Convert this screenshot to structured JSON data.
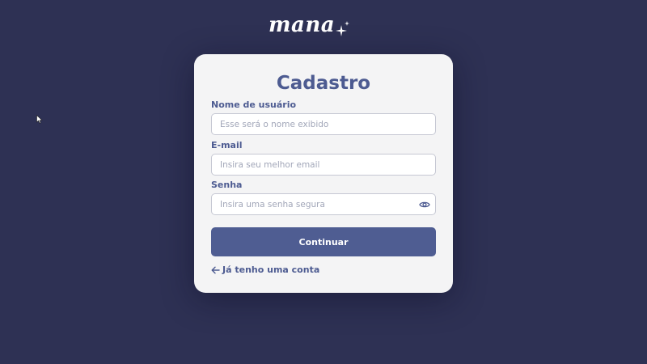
{
  "brand": {
    "name": "mana",
    "sparkle_icon": "sparkle-icon"
  },
  "form": {
    "title": "Cadastro",
    "username": {
      "label": "Nome de usuário",
      "value": "",
      "placeholder": "Esse será o nome exibido"
    },
    "email": {
      "label": "E-mail",
      "value": "",
      "placeholder": "Insira seu melhor email"
    },
    "password": {
      "label": "Senha",
      "value": "",
      "placeholder": "Insira uma senha segura",
      "toggle_icon": "eye-icon"
    },
    "submit_label": "Continuar",
    "back_link": {
      "label": "Já tenho uma conta",
      "icon": "arrow-left-icon"
    }
  },
  "colors": {
    "background": "#2e3154",
    "card": "#f4f4f5",
    "accent": "#4d5b91",
    "button": "#4f5d92"
  }
}
